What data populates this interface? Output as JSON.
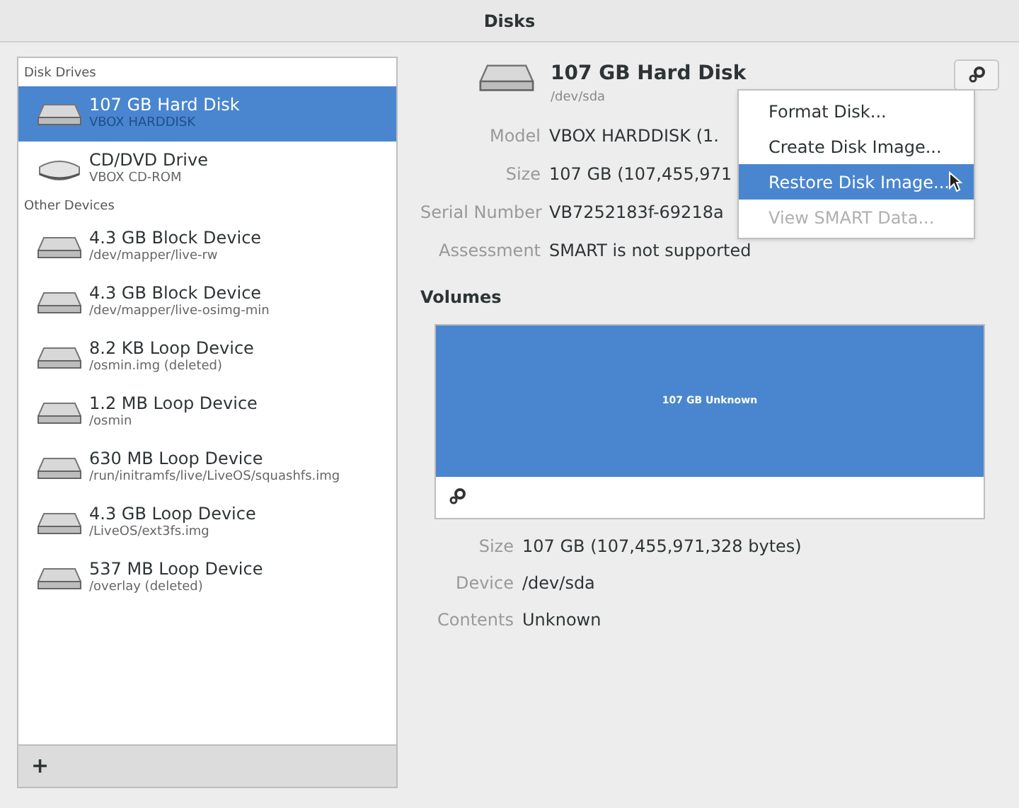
{
  "window": {
    "title": "Disks"
  },
  "sidebar": {
    "groups": [
      {
        "heading": "Disk Drives",
        "items": [
          {
            "name": "107 GB Hard Disk",
            "detail": "VBOX HARDDISK",
            "kind": "hdd",
            "selected": true
          },
          {
            "name": "CD/DVD Drive",
            "detail": "VBOX CD-ROM",
            "kind": "optical",
            "selected": false
          }
        ]
      },
      {
        "heading": "Other Devices",
        "items": [
          {
            "name": "4.3 GB Block Device",
            "detail": "/dev/mapper/live-rw",
            "kind": "hdd",
            "selected": false
          },
          {
            "name": "4.3 GB Block Device",
            "detail": "/dev/mapper/live-osimg-min",
            "kind": "hdd",
            "selected": false
          },
          {
            "name": "8.2 KB Loop Device",
            "detail": "/osmin.img (deleted)",
            "kind": "hdd",
            "selected": false
          },
          {
            "name": "1.2 MB Loop Device",
            "detail": "/osmin",
            "kind": "hdd",
            "selected": false
          },
          {
            "name": "630 MB Loop Device",
            "detail": "/run/initramfs/live/LiveOS/squashfs.img",
            "kind": "hdd",
            "selected": false
          },
          {
            "name": "4.3 GB Loop Device",
            "detail": "/LiveOS/ext3fs.img",
            "kind": "hdd",
            "selected": false
          },
          {
            "name": "537 MB Loop Device",
            "detail": "/overlay (deleted)",
            "kind": "hdd",
            "selected": false
          }
        ]
      }
    ],
    "add_button": "+"
  },
  "disk": {
    "title": "107 GB Hard Disk",
    "device": "/dev/sda",
    "properties": [
      {
        "label": "Model",
        "value": "VBOX HARDDISK (1."
      },
      {
        "label": "Size",
        "value": "107 GB (107,455,971"
      },
      {
        "label": "Serial Number",
        "value": "VB7252183f-69218a"
      },
      {
        "label": "Assessment",
        "value": "SMART is not supported"
      }
    ]
  },
  "menu": {
    "items": [
      {
        "label": "Format Disk...",
        "highlighted": false,
        "disabled": false
      },
      {
        "label": "Create Disk Image...",
        "highlighted": false,
        "disabled": false
      },
      {
        "label": "Restore Disk Image...",
        "highlighted": true,
        "disabled": false
      },
      {
        "label": "View SMART Data...",
        "highlighted": false,
        "disabled": true
      }
    ]
  },
  "volumes": {
    "heading": "Volumes",
    "segment_label": "107 GB Unknown",
    "properties": [
      {
        "label": "Size",
        "value": "107 GB (107,455,971,328 bytes)"
      },
      {
        "label": "Device",
        "value": "/dev/sda"
      },
      {
        "label": "Contents",
        "value": "Unknown"
      }
    ]
  }
}
